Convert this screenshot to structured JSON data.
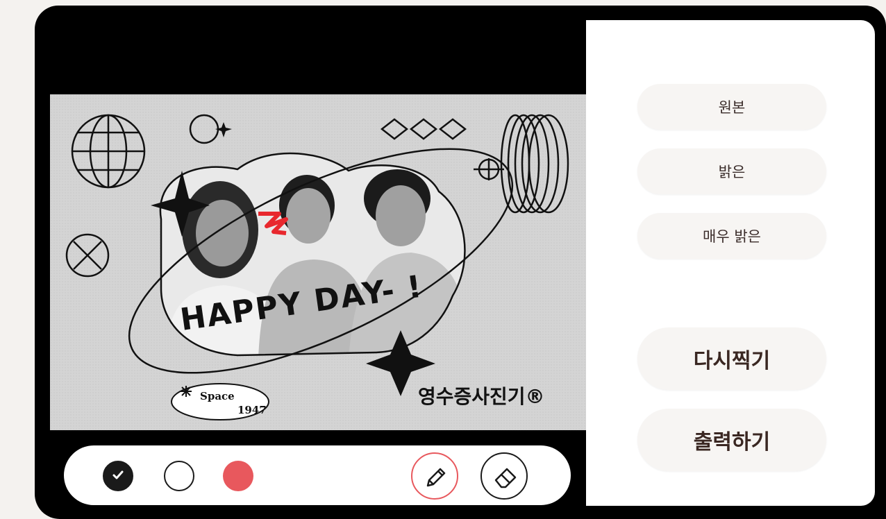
{
  "photo": {
    "caption_handwritten": "HAPPY DAY- !",
    "badge_line1": "Space",
    "badge_line2": "1947",
    "brand_text": "영수증사진기®"
  },
  "toolbar": {
    "swatches": [
      {
        "name": "black",
        "color": "#1a1a1a",
        "selected": true
      },
      {
        "name": "white",
        "color": "#ffffff",
        "selected": false
      },
      {
        "name": "red",
        "color": "#e8585d",
        "selected": false
      }
    ],
    "tools": [
      "pen-icon",
      "eraser-icon"
    ],
    "active_tool": "pen"
  },
  "panel": {
    "filters": [
      "원본",
      "밝은",
      "매우 밝은"
    ],
    "retake_label": "다시찍기",
    "print_label": "출력하기"
  },
  "colors": {
    "accent": "#e8585d",
    "panel_bg": "#ffffff",
    "pill_bg": "#f7f5f3",
    "frame": "#000000"
  }
}
